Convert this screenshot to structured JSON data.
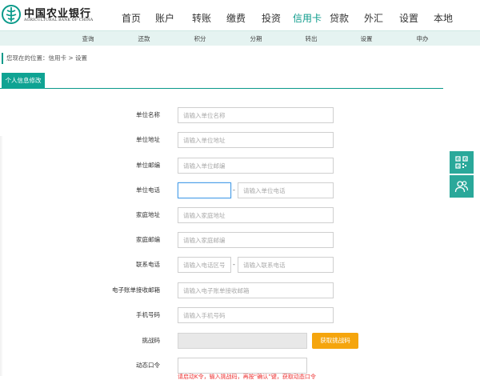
{
  "brand": {
    "name_cn": "中国农业银行",
    "name_en": "AGRICULTURAL BANK OF CHINA",
    "color": "#0a9a8a"
  },
  "main_nav": [
    {
      "label": "首页",
      "active": false
    },
    {
      "label": "账户",
      "active": false
    },
    {
      "label": "转账",
      "active": false
    },
    {
      "label": "缴费",
      "active": false
    },
    {
      "label": "投资",
      "active": false
    },
    {
      "label": "信用卡",
      "active": true
    },
    {
      "label": "贷款",
      "active": false
    },
    {
      "label": "外汇",
      "active": false
    },
    {
      "label": "设置",
      "active": false
    },
    {
      "label": "本地",
      "active": false
    }
  ],
  "sub_nav": [
    {
      "label": "查询"
    },
    {
      "label": "还款"
    },
    {
      "label": "积分"
    },
    {
      "label": "分期"
    },
    {
      "label": "转出"
    },
    {
      "label": "设置"
    },
    {
      "label": "申办"
    }
  ],
  "breadcrumb": "您现在的位置：信用卡 > 设置",
  "tab": {
    "label": "个人信息修改"
  },
  "form": {
    "company_name": {
      "label": "单位名称",
      "placeholder": "请输入单位名称"
    },
    "company_address": {
      "label": "单位地址",
      "placeholder": "请输入单位地址"
    },
    "company_zip": {
      "label": "单位邮编",
      "placeholder": "请输入单位邮编"
    },
    "company_phone": {
      "label": "单位电话",
      "area_placeholder": "",
      "separator": "-",
      "placeholder": "请输入单位电话"
    },
    "home_address": {
      "label": "家庭地址",
      "placeholder": "请输入家庭地址"
    },
    "home_zip": {
      "label": "家庭邮编",
      "placeholder": "请输入家庭邮编"
    },
    "contact_phone": {
      "label": "联系电话",
      "area_placeholder": "请输入电话区号",
      "separator": "-",
      "placeholder": "请输入联系电话"
    },
    "email": {
      "label": "电子账单接收邮箱",
      "placeholder": "请输入电子账单接收邮箱"
    },
    "mobile": {
      "label": "手机号码",
      "placeholder": "请输入手机号码"
    },
    "challenge": {
      "label": "挑战码",
      "button": "获取挑战码"
    },
    "otp": {
      "label": "动态口令",
      "hint": "请启动K令，输入挑战码，再按“确认”键，获取动态口令"
    }
  },
  "colors": {
    "accent": "#0a9a8a",
    "tab_bg": "#0fa393",
    "subnav_bg": "#e5f3f1",
    "button_orange": "#f5a50d",
    "hint_red": "#e33333",
    "float_bg": "#2aa89a"
  },
  "float_icons": [
    "qrcode-icon",
    "user-service-icon"
  ]
}
